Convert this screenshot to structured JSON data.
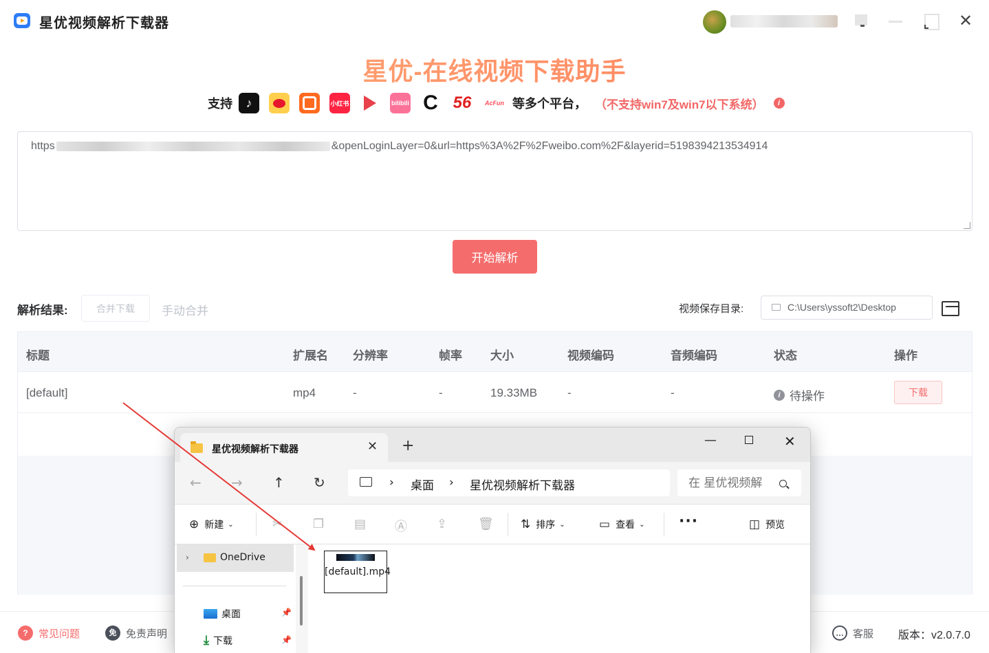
{
  "app": {
    "title": "星优视频解析下载器"
  },
  "header": {
    "heading": "星优-在线视频下载助手",
    "support_label": "支持",
    "platform_icons": [
      {
        "icon": "tiktok-icon",
        "text": "♪"
      },
      {
        "icon": "weibo-icon",
        "text": ""
      },
      {
        "icon": "kuaishou-icon",
        "text": ""
      },
      {
        "icon": "xiaohongshu-icon",
        "text": "小红书"
      },
      {
        "icon": "video-play-icon",
        "text": ""
      },
      {
        "icon": "bilibili-icon",
        "text": "bilibili"
      },
      {
        "icon": "c-platform-icon",
        "text": "C"
      },
      {
        "icon": "56-icon",
        "text": "56"
      },
      {
        "icon": "acfun-icon",
        "text": "AcFun"
      }
    ],
    "more_platforms": "等多个平台，",
    "warning": "（不支持win7及win7以下系统）"
  },
  "url_input": {
    "prefix": "https",
    "suffix": "&openLoginLayer=0&url=https%3A%2F%2Fweibo.com%2F&layerid=5198394213534914"
  },
  "parse_button": "开始解析",
  "results": {
    "label": "解析结果:",
    "merge_button": "合并下载",
    "manual_merge": "手动合并",
    "save_dir_label": "视频保存目录:",
    "save_dir_value": "C:\\Users\\yssoft2\\Desktop"
  },
  "table": {
    "headers": [
      "标题",
      "扩展名",
      "分辨率",
      "帧率",
      "大小",
      "视频编码",
      "音频编码",
      "状态",
      "操作"
    ],
    "rows": [
      {
        "title": "[default]",
        "ext": "mp4",
        "resolution": "-",
        "fps": "-",
        "size": "19.33MB",
        "vcodec": "-",
        "acodec": "-",
        "status": "待操作",
        "action": "下载"
      }
    ]
  },
  "footer": {
    "faq": "常见问题",
    "disclaimer": "免责声明",
    "disclaimer_badge": "免",
    "service": "客服",
    "version": "版本：v2.0.7.0"
  },
  "explorer": {
    "tab_title": "星优视频解析下载器",
    "breadcrumb": [
      "桌面",
      "星优视频解析下载器"
    ],
    "search_placeholder": "在 星优视频解",
    "toolbar": {
      "new": "新建",
      "sort": "排序",
      "view": "查看",
      "preview": "预览"
    },
    "sidebar": [
      "OneDrive",
      "桌面",
      "下载"
    ],
    "file_name": "[default].mp4"
  },
  "colors": {
    "accent": "#f56c6c",
    "heading_gradient": [
      "#ffb07a",
      "#ff7a5a"
    ],
    "arrow": "#e53935"
  }
}
